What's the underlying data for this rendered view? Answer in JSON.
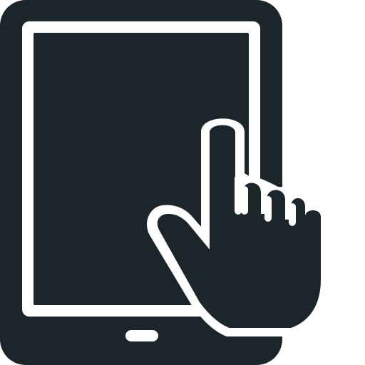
{
  "icon": {
    "name": "tablet-touch-icon",
    "colors": {
      "ink": "#1b252a",
      "background": "#ffffff",
      "screen_frame": "#ffffff"
    }
  }
}
